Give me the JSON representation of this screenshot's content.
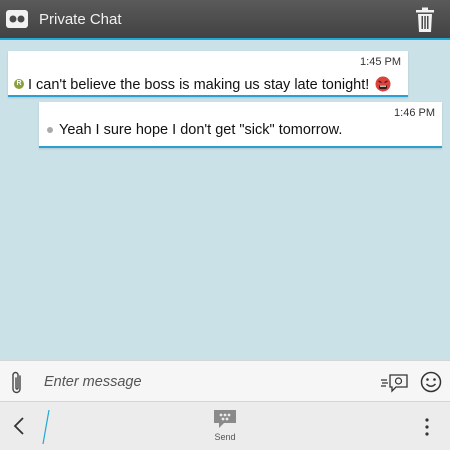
{
  "header": {
    "title": "Private Chat",
    "mask_icon": "private-chat-mask-icon",
    "trash_icon": "trash-icon"
  },
  "messages": [
    {
      "time": "1:45 PM",
      "text": "I can't believe the boss is making us stay late tonight!",
      "sender_badge": "R",
      "emoji": "angry-face-emoji"
    },
    {
      "time": "1:46 PM",
      "text": "Yeah I sure hope I don't get \"sick\" tomorrow."
    }
  ],
  "composer": {
    "placeholder": "Enter message",
    "value": ""
  },
  "actionbar": {
    "send_label": "Send"
  },
  "colors": {
    "header_bg": "#4a4a4a",
    "accent": "#1fa9d6",
    "chat_bg": "#c9e1e7",
    "bubble_bg": "#ffffff",
    "badge": "#8aa23a"
  }
}
